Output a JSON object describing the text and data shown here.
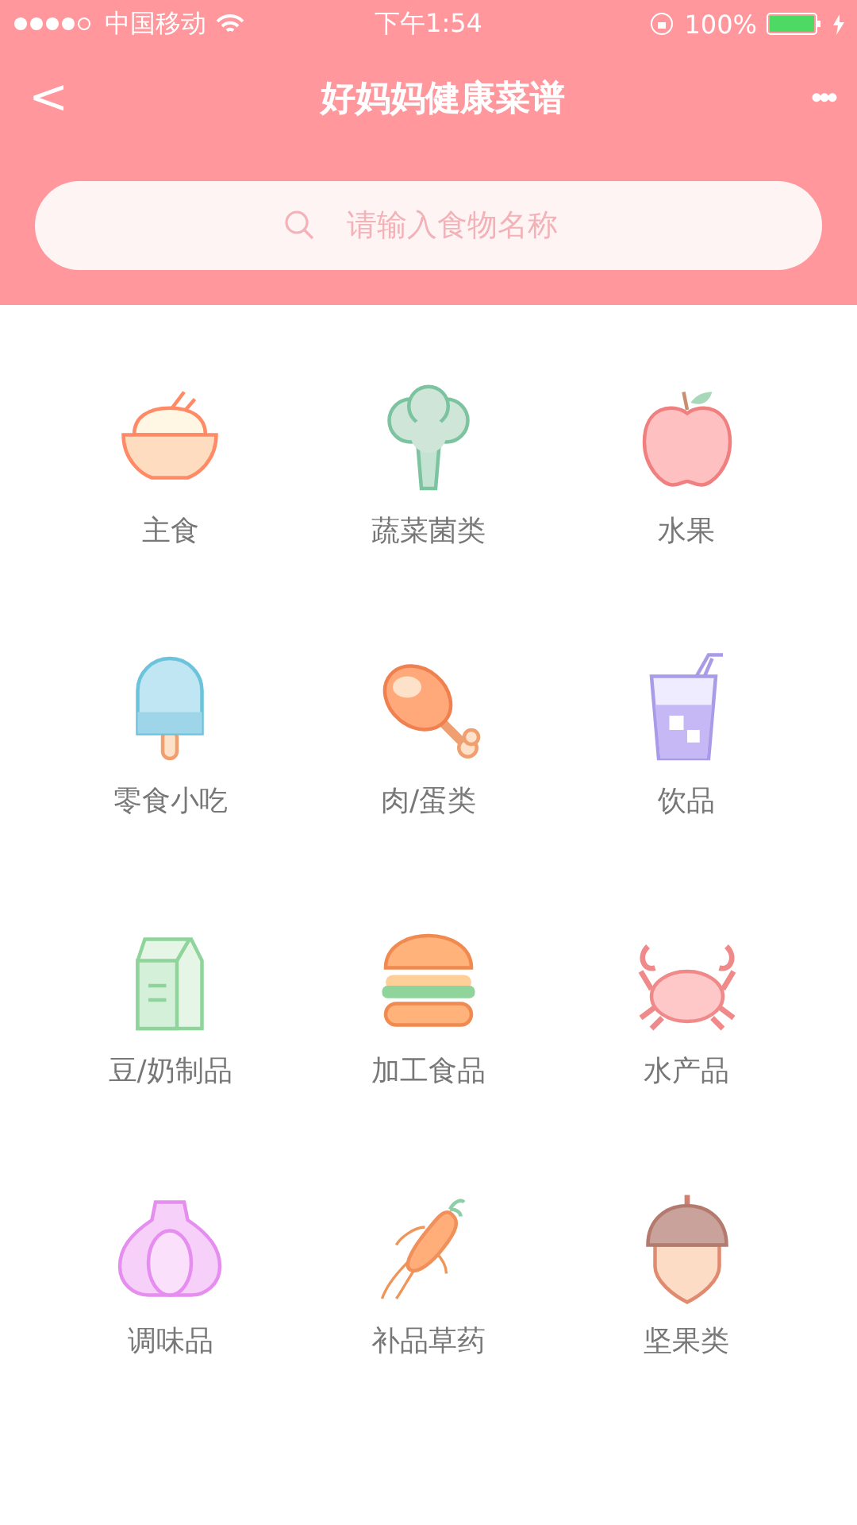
{
  "status_bar": {
    "carrier": "中国移动",
    "time": "下午1:54",
    "battery": "100%"
  },
  "nav_bar": {
    "back": "<",
    "title": "好妈妈健康菜谱",
    "more": "•••"
  },
  "search": {
    "placeholder": "请输入食物名称"
  },
  "categories": [
    {
      "label": "主食",
      "kind": "rice"
    },
    {
      "label": "蔬菜菌类",
      "kind": "broccoli"
    },
    {
      "label": "水果",
      "kind": "apple"
    },
    {
      "label": "零食小吃",
      "kind": "popsicle"
    },
    {
      "label": "肉/蛋类",
      "kind": "meat"
    },
    {
      "label": "饮品",
      "kind": "drink"
    },
    {
      "label": "豆/奶制品",
      "kind": "milk"
    },
    {
      "label": "加工食品",
      "kind": "burger"
    },
    {
      "label": "水产品",
      "kind": "crab"
    },
    {
      "label": "调味品",
      "kind": "garlic"
    },
    {
      "label": "补品草药",
      "kind": "ginseng"
    },
    {
      "label": "坚果类",
      "kind": "acorn"
    }
  ]
}
